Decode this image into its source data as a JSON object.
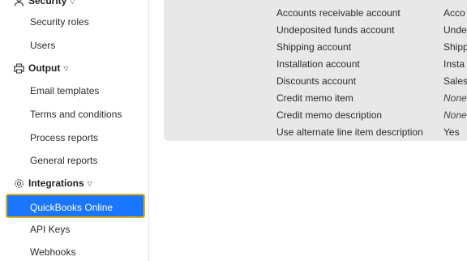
{
  "sidebar": {
    "security": {
      "label": "Security",
      "items": [
        "Security roles",
        "Users"
      ]
    },
    "output": {
      "label": "Output",
      "items": [
        "Email templates",
        "Terms and conditions",
        "Process reports",
        "General reports"
      ]
    },
    "integrations": {
      "label": "Integrations",
      "items": [
        "QuickBooks Online",
        "API Keys",
        "Webhooks"
      ]
    }
  },
  "settings": {
    "rows": [
      {
        "label": "Accounts receivable account",
        "value": "Acco",
        "italic": false
      },
      {
        "label": "Undeposited funds account",
        "value": "Unde",
        "italic": false
      },
      {
        "label": "Shipping account",
        "value": "Shipp",
        "italic": false
      },
      {
        "label": "Installation account",
        "value": "Insta",
        "italic": false
      },
      {
        "label": "Discounts account",
        "value": "Sales",
        "italic": false
      },
      {
        "label": "Credit memo item",
        "value": "None",
        "italic": true
      },
      {
        "label": "Credit memo description",
        "value": "None",
        "italic": true
      },
      {
        "label": "Use alternate line item description",
        "value": "Yes",
        "italic": false
      }
    ]
  },
  "colors": {
    "selected_bg": "#1a76ff",
    "selected_border": "#e0b10f",
    "panel_bg": "#e8e8e8"
  }
}
